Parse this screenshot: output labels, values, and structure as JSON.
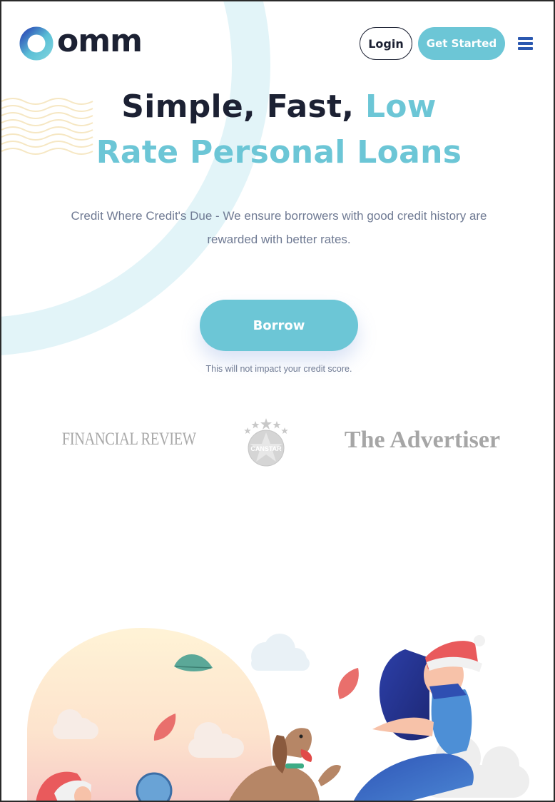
{
  "brand": {
    "name": "omm"
  },
  "header": {
    "login_label": "Login",
    "get_started_label": "Get Started"
  },
  "hero": {
    "title_line1_dark": "Simple, Fast,",
    "title_line1_accent": "Low",
    "title_line2_accent": "Rate Personal Loans",
    "subtitle": "Credit Where Credit's Due - We ensure borrowers with good credit history are rewarded with better rates.",
    "cta_label": "Borrow",
    "credit_note": "This will not impact your credit score."
  },
  "press": {
    "financial_review": "FINANCIAL REVIEW",
    "canstar": "CANSTAR",
    "advertiser": "The Advertiser"
  },
  "icons": {
    "menu": "hamburger-menu-icon",
    "logo": "ring-logo-icon"
  },
  "colors": {
    "accent": "#6cc6d6",
    "dark": "#1c2133",
    "menu_blue": "#2b58b0",
    "muted_text": "#6f7a93"
  }
}
